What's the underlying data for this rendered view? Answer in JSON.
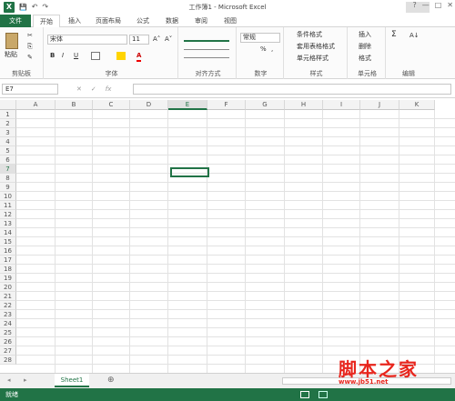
{
  "app": {
    "title": "工作簿1 - Microsoft Excel",
    "logo": "X"
  },
  "qat": {
    "save": "💾",
    "undo": "↶",
    "redo": "↷"
  },
  "winctl": {
    "help": "?",
    "min": "—",
    "max": "□",
    "close": "✕"
  },
  "tabs": [
    "文件",
    "开始",
    "插入",
    "页面布局",
    "公式",
    "数据",
    "审阅",
    "视图"
  ],
  "clipboard": {
    "paste": "粘贴",
    "label": "剪贴板"
  },
  "font": {
    "name": "宋体",
    "size": "11",
    "grow": "A˄",
    "shrink": "A˅",
    "bold": "B",
    "italic": "I",
    "underline": "U",
    "label": "字体"
  },
  "align": {
    "label": "对齐方式"
  },
  "number": {
    "format": "常规",
    "percent": "%",
    "comma": ",",
    "label": "数字"
  },
  "styles": {
    "cond": "条件格式",
    "table": "套用表格格式",
    "cell": "单元格样式",
    "label": "样式"
  },
  "cells": {
    "insert": "插入",
    "delete": "删除",
    "format": "格式",
    "label": "单元格"
  },
  "editing": {
    "sum": "Σ",
    "sort": "A↓",
    "label": "编辑"
  },
  "formula": {
    "namebox": "E7",
    "fx": "fx",
    "cancel": "✕",
    "enter": "✓"
  },
  "columns": [
    "A",
    "B",
    "C",
    "D",
    "E",
    "F",
    "G",
    "H",
    "I",
    "J",
    "K"
  ],
  "rows": [
    "1",
    "2",
    "3",
    "4",
    "5",
    "6",
    "7",
    "8",
    "9",
    "10",
    "11",
    "12",
    "13",
    "14",
    "15",
    "16",
    "17",
    "18",
    "19",
    "20",
    "21",
    "22",
    "23",
    "24",
    "25",
    "26",
    "27",
    "28"
  ],
  "sheet": {
    "name": "Sheet1",
    "add": "⊕",
    "nav_prev": "◂",
    "nav_next": "▸"
  },
  "status": {
    "ready": "就绪"
  },
  "watermark": {
    "text": "脚本之家",
    "url": "www.jb51.net"
  }
}
